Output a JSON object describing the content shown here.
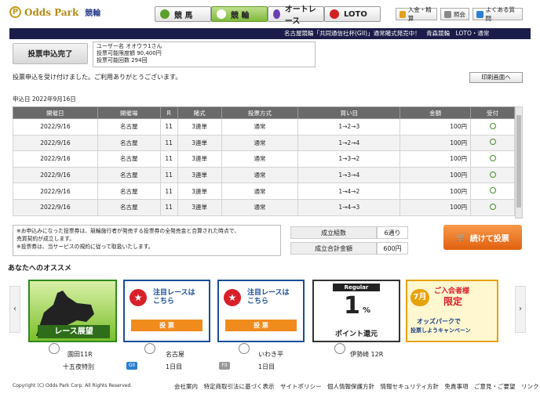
{
  "header": {
    "logo_text": "Odds Park",
    "logo_sub": "競輪",
    "tabs": [
      {
        "label": "競 馬",
        "icon": "horse-icon",
        "color": "#5aa02c"
      },
      {
        "label": "競 輪",
        "icon": "cycle-icon",
        "color": "#ffffff"
      },
      {
        "label": "オートレース",
        "icon": "auto-race-icon",
        "color": "#6a3fb0"
      },
      {
        "label": "LOTO",
        "icon": "loto-icon",
        "color": "#d02020"
      }
    ],
    "buttons": [
      "入金・精算",
      "照会",
      "よくある質問"
    ]
  },
  "ticker": "名古屋競輪「共同通信社杯(GII)」通常賭式発売中！　青森競輪　LOTO・通常",
  "status_box": "投票申込完了",
  "user": {
    "name": "ユーザー名 オオウラ1さん",
    "limit": "投票可能限度額 90,400円",
    "count": "投票可能回数 294回"
  },
  "message": "投票申込を受け付けました。ご利用ありがとうございます。",
  "print_label": "印刷画面へ",
  "apply_date": "申込日 2022年9月16日",
  "table": {
    "headers": [
      "開催日",
      "開催場",
      "R",
      "賭式",
      "投票方式",
      "買い目",
      "金額",
      "受付"
    ],
    "rows": [
      [
        "2022/9/16",
        "名古屋",
        "11",
        "3連単",
        "通常",
        "1→2→3",
        "100円"
      ],
      [
        "2022/9/16",
        "名古屋",
        "11",
        "3連単",
        "通常",
        "1→2→4",
        "100円"
      ],
      [
        "2022/9/16",
        "名古屋",
        "11",
        "3連単",
        "通常",
        "1→3→2",
        "100円"
      ],
      [
        "2022/9/16",
        "名古屋",
        "11",
        "3連単",
        "通常",
        "1→3→4",
        "100円"
      ],
      [
        "2022/9/16",
        "名古屋",
        "11",
        "3連単",
        "通常",
        "1→4→2",
        "100円"
      ],
      [
        "2022/9/16",
        "名古屋",
        "11",
        "3連単",
        "通常",
        "1→4→3",
        "100円"
      ]
    ]
  },
  "notes": [
    "※お申込みになった投票券は、競輪施行者が発売する投票券の全発売金と合算された時点で、",
    "売買契約が成立します。",
    "※投票券は、当サービスの規約に従って取扱いたします。"
  ],
  "summary": {
    "count_label": "成立組数",
    "count_value": "6通り",
    "total_label": "成立合計金額",
    "total_value": "600円"
  },
  "continue_label": "続けて投票",
  "recommend_title": "あなたへのオススメ",
  "cards": {
    "c1": "レース展望",
    "c2_title": "注目レースは\nこちら",
    "c2_btn": "投 票",
    "c3_title": "注目レースは\nこちら",
    "c3_btn": "投 票",
    "c4_top": "Regular",
    "c4_big": "1",
    "c4_pct": "%",
    "c4_bottom": "ポイント還元",
    "c5_month": "7月",
    "c5_l1": "ご入会者様",
    "c5_l2": "限定",
    "c5_l3": "オッズパークで",
    "c5_l4": "投票しようキャンペーン"
  },
  "races": [
    {
      "venue": "園田11R",
      "name": "十五夜特別"
    },
    {
      "venue": "名古屋",
      "name": "1日目",
      "badge": "GII"
    },
    {
      "venue": "いわき平",
      "name": "1日目",
      "badge": "FII"
    },
    {
      "venue": "伊勢崎 12R",
      "name": ""
    }
  ],
  "copyright": "Copyright (C) Odds Park Corp. All Rights Reserved.",
  "footer_links": "会社案内　特定商取引法に基づく表示　サイトポリシー　個人情報保護方針　情報セキュリティ方針　免責事項　ご意見・ご要望　リンク"
}
